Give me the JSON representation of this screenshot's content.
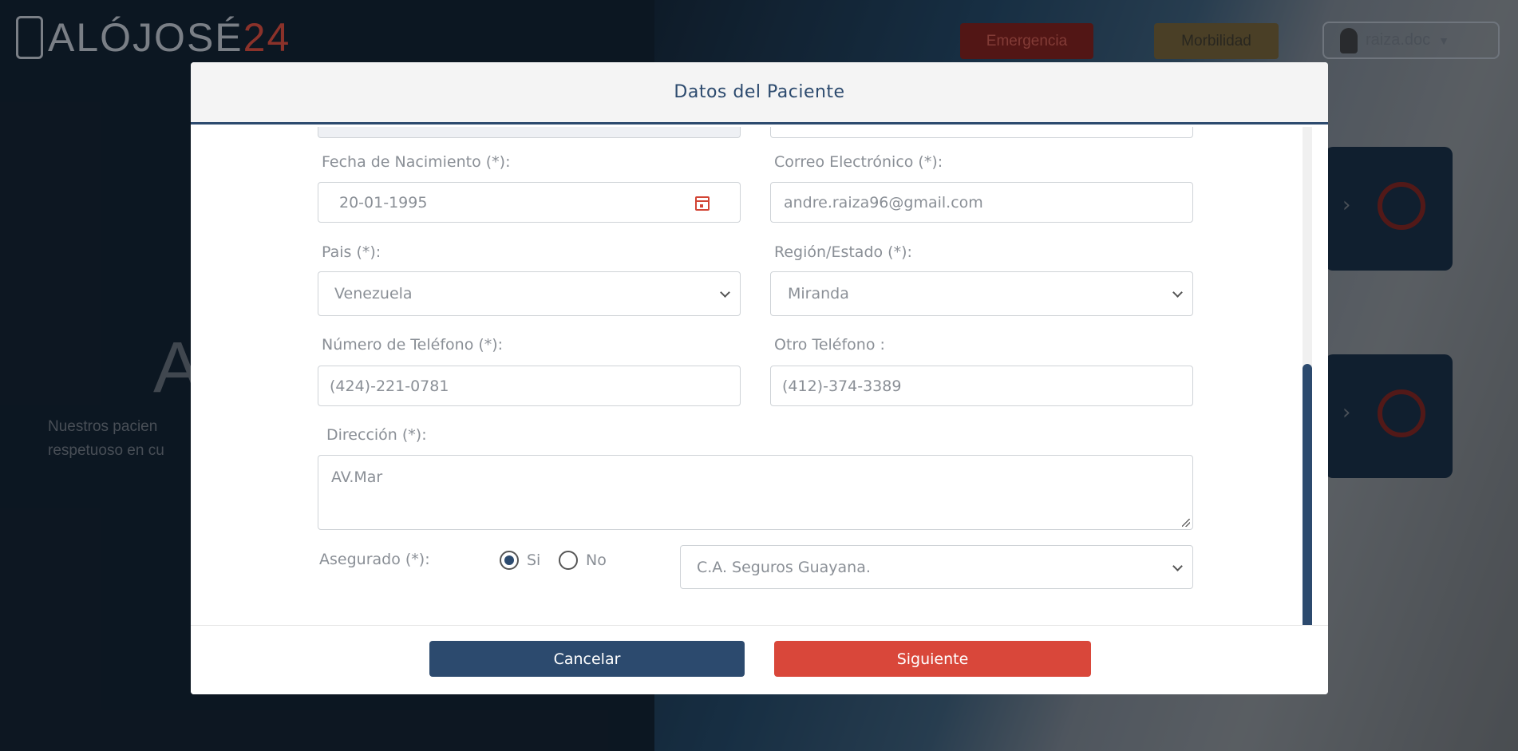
{
  "background": {
    "logo_text": "ALÓJOSÉ",
    "logo_number": "24",
    "emergency_label": "Emergencia",
    "morbilidad_label": "Morbilidad",
    "username": "raiza.doc",
    "heading_fragment": "Al",
    "text_line1": "Nuestros pacien",
    "text_line2": "respetuoso en cu"
  },
  "modal": {
    "title": "Datos del Paciente",
    "fields": {
      "birthdate": {
        "label": "Fecha de Nacimiento (*):",
        "value": "20-01-1995"
      },
      "email": {
        "label": "Correo Electrónico (*):",
        "value": "andre.raiza96@gmail.com"
      },
      "country": {
        "label": "Pais (*):",
        "value": "Venezuela"
      },
      "region": {
        "label": "Región/Estado (*):",
        "value": "Miranda"
      },
      "phone": {
        "label": "Número de Teléfono (*):",
        "value": "(424)-221-0781"
      },
      "other_phone": {
        "label": "Otro Teléfono :",
        "value": "(412)-374-3389"
      },
      "address": {
        "label": "Dirección (*):",
        "value": "AV.Mar"
      },
      "insured": {
        "label": "Asegurado (*):",
        "yes": "Si",
        "no": "No",
        "selected": "Si"
      },
      "insurer": {
        "value": "C.A. Seguros Guayana."
      }
    },
    "buttons": {
      "cancel": "Cancelar",
      "next": "Siguiente"
    }
  },
  "colors": {
    "primary": "#2c4a6e",
    "accent": "#d9473a"
  }
}
